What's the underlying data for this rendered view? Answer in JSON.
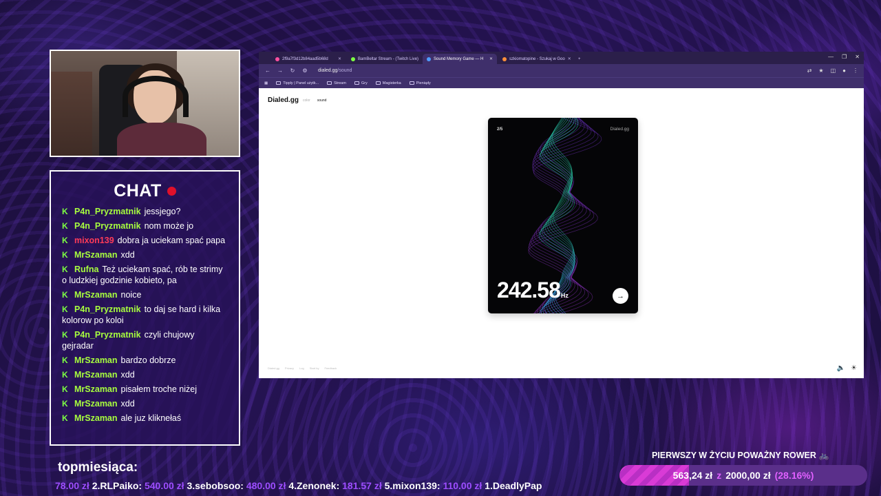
{
  "chat": {
    "title": "CHAT",
    "messages": [
      {
        "user": "P4n_Pryzmatnik",
        "text": "jessjego?",
        "red": false
      },
      {
        "user": "P4n_Pryzmatnik",
        "text": "nom może jo",
        "red": false
      },
      {
        "user": "mixon139",
        "text": "dobra ja uciekam spać papa",
        "red": true
      },
      {
        "user": "MrSzaman",
        "text": "xdd",
        "red": false
      },
      {
        "user": "Rufna",
        "text": "Też uciekam spać, rób te strimy o ludzkiej godzinie kobieto, pa",
        "red": false
      },
      {
        "user": "MrSzaman",
        "text": "noice",
        "red": false
      },
      {
        "user": "P4n_Pryzmatnik",
        "text": "to daj se hard i kilka kolorow po koloi",
        "red": false
      },
      {
        "user": "P4n_Pryzmatnik",
        "text": "czyli chujowy gejradar",
        "red": false
      },
      {
        "user": "MrSzaman",
        "text": "bardzo dobrze",
        "red": false
      },
      {
        "user": "MrSzaman",
        "text": "xdd",
        "red": false
      },
      {
        "user": "MrSzaman",
        "text": "pisałem troche niżej",
        "red": false
      },
      {
        "user": "MrSzaman",
        "text": "xdd",
        "red": false
      },
      {
        "user": "MrSzaman",
        "text": "ale juz kliknełaś",
        "red": false
      }
    ]
  },
  "browser": {
    "tabs": [
      {
        "label": "2f9a7f3d12b84aad5b68d",
        "color": "#ff4fa0",
        "active": false
      },
      {
        "label": "BamBeltar Stream - (Twitch Live)",
        "color": "#7dff43",
        "active": false
      },
      {
        "label": "Sound Memory Game — H",
        "color": "#4f9dff",
        "active": true
      },
      {
        "label": "szkiomatopine - Szukaj w Goo",
        "color": "#ff8f3a",
        "active": false
      }
    ],
    "url_host": "dialed.gg",
    "url_path": "/sound",
    "bookmarks": [
      "Tipply | Panel użytk...",
      "Stream",
      "Gry",
      "Magisterka",
      "Pieniądy"
    ]
  },
  "site": {
    "logo": "Dialed.gg",
    "nav_off": "color",
    "nav_on": "sound",
    "card_count": "2/5",
    "card_brand": "Dialed.gg",
    "frequency": "242.58",
    "unit": "Hz",
    "go_icon": "→",
    "footer": [
      "Dialed.gg",
      "Privacy",
      "Log",
      "Start by",
      "Feedback"
    ]
  },
  "stream": {
    "top_title": "topmiesiąca:",
    "ticker": [
      {
        "amount": "78.00 zł",
        "name": "2.RLPaiko:"
      },
      {
        "amount": "540.00 zł",
        "name": "3.sebobsoo:"
      },
      {
        "amount": "480.00 zł",
        "name": "4.Zenonek:"
      },
      {
        "amount": "181.57 zł",
        "name": "5.mixon139:"
      },
      {
        "amount": "110.00 zł",
        "name": "1.DeadlyPap"
      }
    ],
    "goal_title": "PIERWSZY W ŻYCIU POWAŻNY ROWER",
    "goal_current": "563,24 zł",
    "goal_sep": "z",
    "goal_target": "2000,00 zł",
    "goal_percent": "(28.16%)",
    "goal_fraction": 0.2816
  },
  "colors": {
    "accent_purple": "#9d4dff",
    "username_green": "#a8ff3e",
    "username_red": "#ff3b57",
    "live_dot": "#e0102a"
  }
}
